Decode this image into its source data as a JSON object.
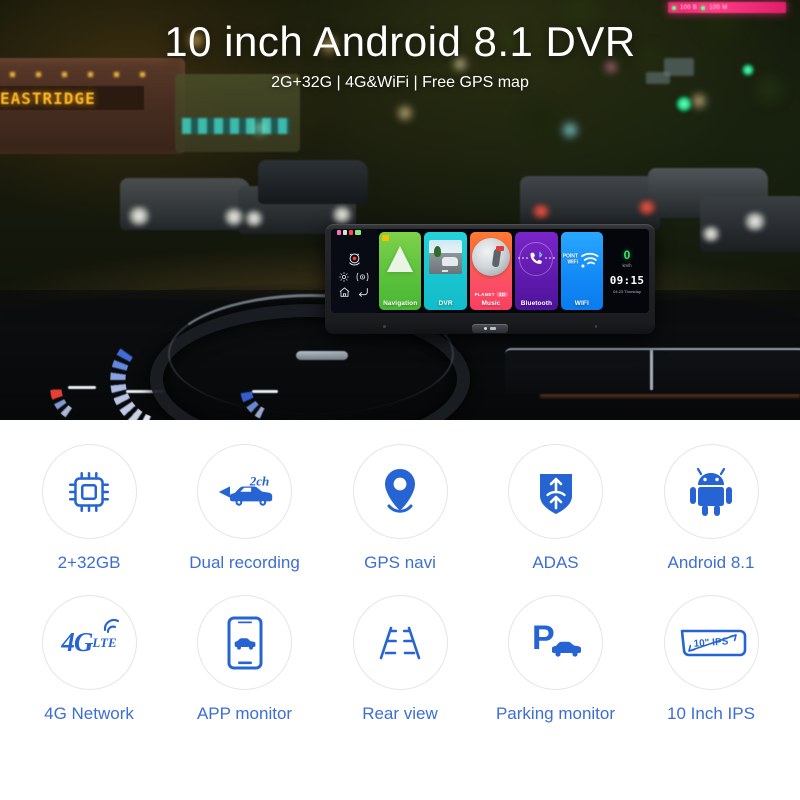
{
  "hero": {
    "headline": "10 inch Android 8.1 DVR",
    "subtitle": "2G+32G | 4G&WiFi | Free GPS map",
    "bus_destination_sign": "EASTRIDGE"
  },
  "device": {
    "tiles": [
      {
        "label": "Navigation",
        "icon": "navigation-arrow-icon",
        "color": "#5cc23c"
      },
      {
        "label": "DVR",
        "icon": "dashcam-road-icon",
        "color": "#18c4cf"
      },
      {
        "label": "Music",
        "icon": "album-disc-icon",
        "color": "#fb4f64",
        "album_text": "PLANET",
        "album_badge": "3D"
      },
      {
        "label": "Bluetooth",
        "icon": "bluetooth-phone-icon",
        "color": "#5e19ad"
      },
      {
        "label": "WIFI",
        "icon": "wifi-signal-icon",
        "color": "#1188f5",
        "badge_line1": "POINT",
        "badge_line2": "WiFi"
      }
    ],
    "sidebar_icons": [
      "record-camera-icon",
      "settings-gear-icon",
      "camera-mode-icon",
      "home-icon",
      "back-arrow-icon"
    ],
    "status_panel": {
      "speed_value": "0",
      "speed_unit": "km/h",
      "clock": "09:15",
      "date": "04.23 Thursday"
    },
    "home_button": "home-hardware-button"
  },
  "features": {
    "row1": [
      {
        "label": "2+32GB",
        "icon": "cpu-chip-icon"
      },
      {
        "label": "Dual recording",
        "icon": "dual-channel-car-icon",
        "badge": "2ch"
      },
      {
        "label": "GPS navi",
        "icon": "map-pin-icon"
      },
      {
        "label": "ADAS",
        "icon": "shield-arrows-icon"
      },
      {
        "label": "Android 8.1",
        "icon": "android-robot-icon"
      }
    ],
    "row2": [
      {
        "label": "4G Network",
        "icon": "4g-lte-icon",
        "text_main": "4G",
        "text_sub": "LTE"
      },
      {
        "label": "APP monitor",
        "icon": "phone-car-icon"
      },
      {
        "label": "Rear view",
        "icon": "parking-guide-lines-icon"
      },
      {
        "label": "Parking monitor",
        "icon": "parking-p-car-icon",
        "badge": "P"
      },
      {
        "label": "10 Inch IPS",
        "icon": "mirror-screen-icon",
        "badge": "10\" IPS"
      }
    ]
  },
  "colors": {
    "accent_blue": "#2664d4",
    "label_blue": "#3d6ed4",
    "circle_border": "#e3e5e8",
    "speed_green": "#39e06b",
    "background": "#ffffff"
  }
}
